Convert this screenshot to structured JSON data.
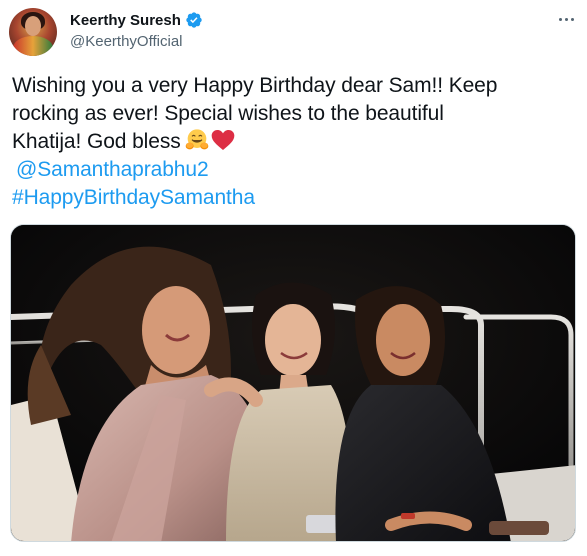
{
  "tweet": {
    "author": {
      "display_name": "Keerthy Suresh",
      "handle": "@KeerthyOfficial",
      "verified": true,
      "avatar_icon": "profile-photo"
    },
    "text_lines": [
      "Wishing you a very Happy Birthday dear Sam!! Keep",
      "rocking as ever! Special wishes to the beautiful",
      "Khatija! God bless"
    ],
    "emojis": [
      "hugging-face-emoji",
      "red-heart-emoji"
    ],
    "mention": "@Samanthaprabhu2",
    "hashtag": "#HappyBirthdaySamantha",
    "more_icon": "more-horizontal-icon",
    "media": {
      "type": "photo",
      "content_icon": "photo-three-women-on-boat-at-night"
    }
  },
  "colors": {
    "text": "#0f1419",
    "secondary": "#536471",
    "link": "#1d9bf0",
    "verified": "#1d9bf0",
    "border": "#cfd9de"
  }
}
